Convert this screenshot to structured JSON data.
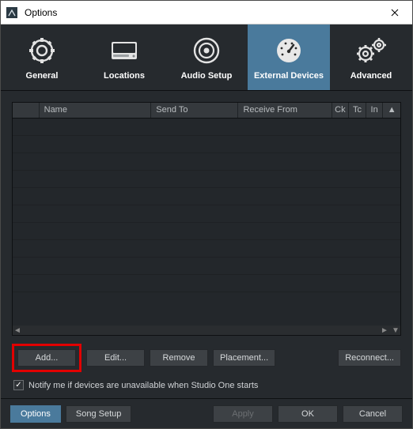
{
  "window": {
    "title": "Options"
  },
  "tabs": {
    "general": {
      "label": "General"
    },
    "locations": {
      "label": "Locations"
    },
    "audio": {
      "label": "Audio Setup"
    },
    "external": {
      "label": "External Devices"
    },
    "advanced": {
      "label": "Advanced"
    }
  },
  "table": {
    "columns": {
      "name": "Name",
      "sendto": "Send To",
      "receive": "Receive From",
      "ck": "Ck",
      "tc": "Tc",
      "in": "In"
    }
  },
  "buttons": {
    "add": "Add...",
    "edit": "Edit...",
    "remove": "Remove",
    "placement": "Placement...",
    "reconnect": "Reconnect..."
  },
  "notify": {
    "label": "Notify me if devices are unavailable when Studio One starts",
    "checked": true
  },
  "footer": {
    "options_tab": "Options",
    "songsetup_tab": "Song Setup",
    "apply": "Apply",
    "ok": "OK",
    "cancel": "Cancel"
  }
}
